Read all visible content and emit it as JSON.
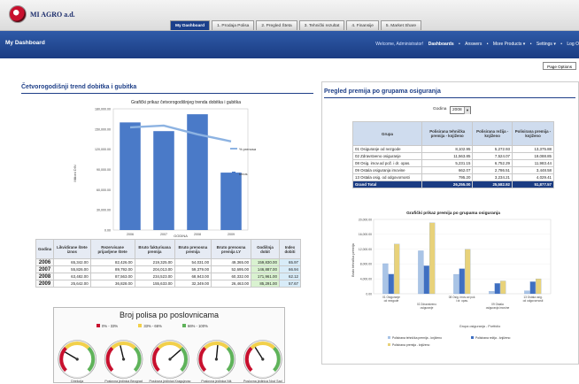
{
  "app": {
    "logo_text": "MI AGRO a.d."
  },
  "tabs": [
    {
      "label": "My Dashboard",
      "active": true
    },
    {
      "label": "1. Prodaja Polisa",
      "active": false
    },
    {
      "label": "2. Pregled Šteta",
      "active": false
    },
    {
      "label": "3. Tehnički rezultat",
      "active": false
    },
    {
      "label": "4. Finansije",
      "active": false
    },
    {
      "label": "5. Market Share",
      "active": false
    }
  ],
  "header": {
    "title": "My Dashboard",
    "welcome": "Welcome, Administrator!",
    "nav": [
      "Dashboards",
      "Answers",
      "More Products ▾",
      "Settings ▾",
      "Log O"
    ],
    "page_options": "Page Options"
  },
  "left_panel": {
    "title": "Četvorogodišnji trend dobitka i gubitka",
    "chart": {
      "title": "Grafički prikaz četvorogodišnjeg trenda dobitka i gubitka",
      "ylabel": "Milioni DIN",
      "xlabel": "GODINA",
      "y_ticks": [
        "180,000.00",
        "150,000.00",
        "120,000.00",
        "90,000.00",
        "60,000.00",
        "30,000.00",
        "0.00"
      ],
      "legend": [
        "% prenosa",
        "Iznos"
      ]
    },
    "table": {
      "headers": [
        "Godina",
        "Likvidirane štete iznos",
        "Rezervisane prijavljene štete",
        "Bruto fakturisana premija",
        "Bruto prenosna premija",
        "Bruto prenosna premija LY",
        "Godišnja dobit",
        "Index dobiti"
      ],
      "rows": [
        [
          "2006",
          "65,342.00",
          "82,426.00",
          "219,325.00",
          "54,031.00",
          "49,365.00",
          "159,830.00",
          "65.97"
        ],
        [
          "2007",
          "55,826.00",
          "89,792.00",
          "204,013.00",
          "59,379.00",
          "52,695.00",
          "146,887.00",
          "66.94"
        ],
        [
          "2008",
          "63,482.00",
          "87,563.00",
          "234,523.00",
          "68,943.00",
          "60,332.00",
          "171,961.00",
          "62.12"
        ],
        [
          "2009",
          "25,642.00",
          "36,828.00",
          "155,633.00",
          "32,349.00",
          "26,463.00",
          "85,291.00",
          "57.67"
        ]
      ]
    }
  },
  "chart_data": [
    {
      "type": "bar",
      "title": "Grafički prikaz četvorogodišnjeg trenda dobitka i gubitka",
      "xlabel": "GODINA",
      "ylabel": "Milioni DIN",
      "categories": [
        "2006",
        "2007",
        "2008",
        "2009"
      ],
      "ylim": [
        0,
        180000
      ],
      "series": [
        {
          "name": "Iznos",
          "type": "bar",
          "values": [
            159830,
            146887,
            171961,
            85291
          ]
        },
        {
          "name": "% prenosa",
          "type": "line",
          "values": [
            66,
            67,
            62,
            58
          ]
        }
      ],
      "grid": false,
      "legend": "right"
    },
    {
      "type": "bar",
      "title": "Grafički prikaz premija po grupama osiguranja",
      "xlabel": "Grupa osiguranja - Portfolio",
      "ylabel": "Bruto tehnička premija",
      "categories": [
        "01 Osiguranje od nezgode",
        "02 Zdravstveno osiguranje",
        "08 Osig. imov.od pož. i dr. opas.",
        "09 Ostala osiguranja imovine",
        "13 Ostala osig. od odgovornosti"
      ],
      "ylim": [
        0,
        20000
      ],
      "y_ticks": [
        "20,000.00",
        "16,000.00",
        "12,000.00",
        "8,000.00",
        "4,000.00",
        "0.00"
      ],
      "series": [
        {
          "name": "Polisirana tehnička premija - knjiženo",
          "values": [
            8102.95,
            11563.85,
            5231.15,
            662.07,
            795.2
          ]
        },
        {
          "name": "Polisirana režija - knjiženo",
          "values": [
            5272.93,
            7524.07,
            6752.29,
            2786.51,
            3234.21
          ]
        },
        {
          "name": "Polisirana premija - knjiženo",
          "values": [
            13375.88,
            19088.85,
            11983.44,
            3448.58,
            4029.41
          ]
        }
      ],
      "legend": "bottom"
    }
  ],
  "right_panel": {
    "title": "Pregled premija po grupama osiguranja",
    "filter_label": "Godina",
    "filter_value": "2008",
    "table": {
      "headers": [
        "Grupa",
        "Polisirana tehnička premija - knjiženo",
        "Polisirana režija - knjiženo",
        "Polisirana premija - knjiženo"
      ],
      "rows": [
        [
          "01 Osiguranje od nezgode",
          "8,102.95",
          "5,272.93",
          "13,375.88"
        ],
        [
          "02 Zdravstveno osiguranje",
          "11,563.85",
          "7,524.07",
          "19,088.85"
        ],
        [
          "08 Osig. imov.od pož. i dr. opas.",
          "5,231.15",
          "6,752.29",
          "11,983.44"
        ],
        [
          "09 Ostala osiguranja imovine",
          "662.07",
          "2,786.51",
          "3,448.58"
        ],
        [
          "13 Ostala osig. od odgovornosti",
          "795.20",
          "3,234.21",
          "4,029.41"
        ]
      ],
      "total": [
        "Grand Total",
        "26,255.00",
        "25,582.92",
        "51,877.57"
      ]
    },
    "chart": {
      "title": "Grafički prikaz premija po grupama osiguranja",
      "ylabel": "Bruto tehnička premija",
      "xlabel": "Grupa osiguranja - Portfolio",
      "xcats": [
        "01 Osiguranje od nezgode",
        "02 Zdravstveno osiguranje",
        "08 Osig. imov.od pož. i dr. opas.",
        "09 Ostala osiguranja imovine",
        "13 Ostala osig. od odgovornosti"
      ],
      "legend": [
        "Polisirana tehnička premija - knjiženo",
        "Polisirana režija - knjiženo",
        "Polisirana premija - knjiženo"
      ]
    }
  },
  "gauges": {
    "title": "Broj polisa po poslovnicama",
    "legend": [
      "0% - 33%",
      "33% - 66%",
      "66% - 100%"
    ],
    "items": [
      {
        "label": "Direkcija",
        "value": 0.28
      },
      {
        "label": "Poslovna jedinica Beograd",
        "value": 0.45
      },
      {
        "label": "Poslovna jedinica Kragujevac",
        "value": 0.68
      },
      {
        "label": "Poslovna jedinica Niš",
        "value": 0.52
      },
      {
        "label": "Poslovna jedinica Novi Sad",
        "value": 0.38
      }
    ]
  },
  "colors": {
    "brand_blue": "#1b3c82",
    "bar_blue": "#4a7ac8",
    "light_blue": "#a9c4e6",
    "yellow": "#e8d27a",
    "gauge_red": "#c8102e",
    "gauge_yellow": "#f2d04a",
    "gauge_green": "#5fb35a"
  }
}
